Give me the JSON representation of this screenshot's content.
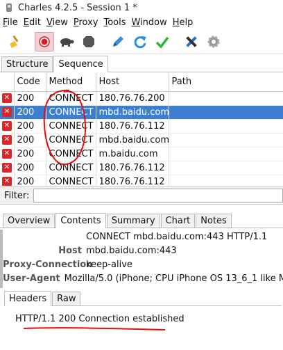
{
  "window": {
    "title": "Charles 4.2.5 - Session 1 *"
  },
  "menu": [
    "File",
    "Edit",
    "View",
    "Proxy",
    "Tools",
    "Window",
    "Help"
  ],
  "menu_underline": [
    "F",
    "E",
    "V",
    "P",
    "T",
    "W",
    "H"
  ],
  "toolbar": {
    "icons": [
      "broom-icon",
      "record-icon",
      "throttle-turtle-icon",
      "stop-hexagon-icon",
      "pen-icon",
      "refresh-icon",
      "checkmark-icon",
      "tools-icon",
      "settings-gear-icon"
    ]
  },
  "view_tabs": [
    "Structure",
    "Sequence"
  ],
  "table": {
    "headers": [
      "",
      "Code",
      "Method",
      "Host",
      "Path"
    ],
    "rows": [
      {
        "code": "200",
        "method": "CONNECT",
        "host": "180.76.76.200",
        "path": ""
      },
      {
        "code": "200",
        "method": "CONNECT",
        "host": "mbd.baidu.com",
        "path": "",
        "selected": true
      },
      {
        "code": "200",
        "method": "CONNECT",
        "host": "180.76.76.112",
        "path": ""
      },
      {
        "code": "200",
        "method": "CONNECT",
        "host": "mbd.baidu.com",
        "path": ""
      },
      {
        "code": "200",
        "method": "CONNECT",
        "host": "m.baidu.com",
        "path": ""
      },
      {
        "code": "200",
        "method": "CONNECT",
        "host": "180.76.76.112",
        "path": ""
      },
      {
        "code": "200",
        "method": "CONNECT",
        "host": "180.76.76.112",
        "path": ""
      }
    ]
  },
  "filter": {
    "label": "Filter:",
    "value": ""
  },
  "detail_tabs": [
    "Overview",
    "Contents",
    "Summary",
    "Chart",
    "Notes"
  ],
  "request_headers": {
    "request_line": "CONNECT mbd.baidu.com:443 HTTP/1.1",
    "rows": [
      {
        "key": "Host",
        "value": "mbd.baidu.com:443"
      },
      {
        "key": "Proxy-Connection",
        "value": "keep-alive"
      },
      {
        "key": "User-Agent",
        "value": "Mozilla/5.0 (iPhone; CPU iPhone OS 13_6_1 like M"
      }
    ]
  },
  "response_tabs": [
    "Headers",
    "Raw"
  ],
  "response": {
    "status_line": "HTTP/1.1 200 Connection established"
  },
  "colors": {
    "selection": "#3c7fd0",
    "error_icon": "#d8282a",
    "annotation": "#e01010"
  }
}
